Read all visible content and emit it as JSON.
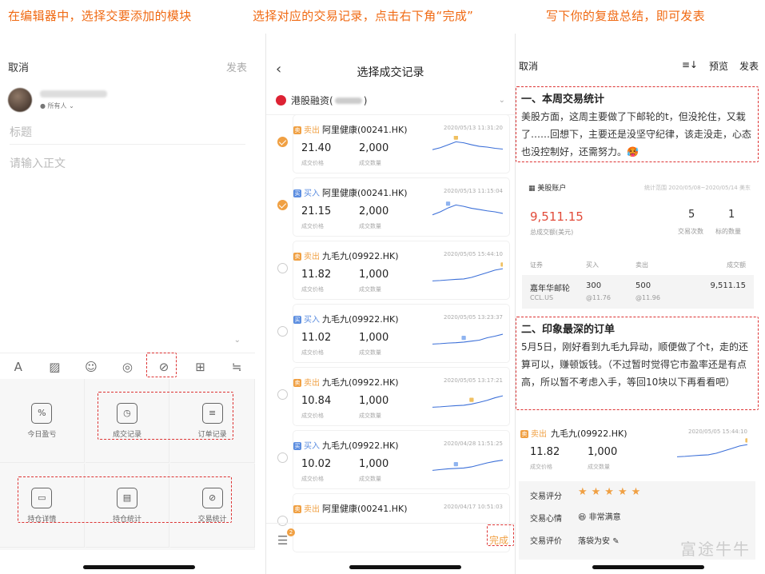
{
  "captions": [
    "在编辑器中，选择交要添加的模块",
    "选择对应的交易记录，点击右下角“完成”",
    "写下你的复盘总结，即可发表"
  ],
  "editor": {
    "cancel": "取消",
    "publish": "发表",
    "visibility": "所有人",
    "title_placeholder": "标题",
    "body_placeholder": "请输入正文",
    "toolbar_icons": [
      "font-icon",
      "image-icon",
      "emoji-icon",
      "stock-icon",
      "trade-chart-icon",
      "add-icon",
      "wrap-icon"
    ],
    "modules": [
      {
        "label": "今日盈亏",
        "icon": "%"
      },
      {
        "label": "成交记录",
        "icon": "◷"
      },
      {
        "label": "订单记录",
        "icon": "≡"
      },
      {
        "label": "持仓详情",
        "icon": "▭"
      },
      {
        "label": "持仓统计",
        "icon": "▤"
      },
      {
        "label": "交易统计",
        "icon": "⊘"
      }
    ]
  },
  "select": {
    "back": "‹",
    "title": "选择成交记录",
    "account": "港股融资(",
    "account_suffix": ")",
    "done": "完成",
    "badge": "2",
    "price_label": "成交价格",
    "qty_label": "成交数量",
    "records": [
      {
        "side": "卖出",
        "type": "sell",
        "name": "阿里健康(00241.HK)",
        "time": "2020/05/13 11:31:20",
        "price": "21.40",
        "qty": "2,000",
        "checked": true,
        "trend": [
          0.45,
          0.55,
          0.7,
          0.85,
          0.8,
          0.7,
          0.62,
          0.58,
          0.52,
          0.48
        ],
        "marker": 3
      },
      {
        "side": "买入",
        "type": "buy",
        "name": "阿里健康(00241.HK)",
        "time": "2020/05/13 11:15:04",
        "price": "21.15",
        "qty": "2,000",
        "checked": true,
        "trend": [
          0.35,
          0.5,
          0.7,
          0.85,
          0.78,
          0.68,
          0.62,
          0.55,
          0.5,
          0.42
        ],
        "marker": 2
      },
      {
        "side": "卖出",
        "type": "sell",
        "name": "九毛九(09922.HK)",
        "time": "2020/05/05 15:44:10",
        "price": "11.82",
        "qty": "1,000",
        "checked": false,
        "trend": [
          0.2,
          0.22,
          0.25,
          0.28,
          0.3,
          0.38,
          0.5,
          0.62,
          0.75,
          0.82
        ],
        "marker": 9
      },
      {
        "side": "买入",
        "type": "buy",
        "name": "九毛九(09922.HK)",
        "time": "2020/05/05 13:23:37",
        "price": "11.02",
        "qty": "1,000",
        "checked": false,
        "trend": [
          0.2,
          0.22,
          0.25,
          0.27,
          0.3,
          0.35,
          0.4,
          0.52,
          0.6,
          0.7
        ],
        "marker": 4
      },
      {
        "side": "卖出",
        "type": "sell",
        "name": "九毛九(09922.HK)",
        "time": "2020/05/05 13:17:21",
        "price": "10.84",
        "qty": "1,000",
        "checked": false,
        "trend": [
          0.2,
          0.22,
          0.25,
          0.28,
          0.3,
          0.36,
          0.45,
          0.55,
          0.68,
          0.78
        ],
        "marker": 5
      },
      {
        "side": "买入",
        "type": "buy",
        "name": "九毛九(09922.HK)",
        "time": "2020/04/28 11:51:25",
        "price": "10.02",
        "qty": "1,000",
        "checked": false,
        "trend": [
          0.2,
          0.24,
          0.28,
          0.3,
          0.32,
          0.38,
          0.48,
          0.58,
          0.66,
          0.72
        ],
        "marker": 3
      },
      {
        "side": "卖出",
        "type": "sell",
        "name": "阿里健康(00241.HK)",
        "time": "2020/04/17 10:51:03",
        "price": "",
        "qty": "",
        "checked": false,
        "trend": [],
        "marker": 0
      }
    ]
  },
  "review": {
    "cancel": "取消",
    "sort_icon": "≡↓",
    "preview": "预览",
    "publish": "发表",
    "sec1_title": "一、本周交易统计",
    "sec1_text": "美股方面，这周主要做了下邮轮的t，但没抡住，又栽了……回想下，主要还是没坚守纪律，该走没走，心态也没控制好，还需努力。",
    "sec1_emoji": "🥵",
    "stat": {
      "account": "美股账户",
      "range": "统计范围 2020/05/08~2020/05/14 美东",
      "total": "9,511.15",
      "total_label": "总成交额(美元)",
      "count": "5",
      "count_label": "交易次数",
      "targets": "1",
      "targets_label": "标的数量",
      "headers": [
        "证券",
        "买入",
        "卖出",
        "成交额"
      ],
      "row": {
        "name": "嘉年华邮轮",
        "code": "CCL.US",
        "buy": "300",
        "buy_price": "@11.76",
        "sell": "500",
        "sell_price": "@11.96",
        "amount": "9,511.15"
      }
    },
    "sec2_title": "二、印象最深的订单",
    "sec2_text": "5月5日，刚好看到九毛九异动，顺便做了个t，走的还算可以，赚顿饭钱。（不过暂时觉得它市盈率还是有点高，所以暂不考虑入手，等回10块以下再看看吧）",
    "trade": {
      "side": "卖出",
      "name": "九毛九(09922.HK)",
      "time": "2020/05/05 15:44:10",
      "price": "11.82",
      "price_label": "成交价格",
      "qty": "1,000",
      "qty_label": "成交数量",
      "rating_label": "交易评分",
      "stars": "★★★★★",
      "mood_label": "交易心情",
      "mood": "非常满意",
      "mood_emoji": "😆",
      "eval_label": "交易评价",
      "eval": "落袋为安"
    },
    "watermark": "富途牛牛"
  }
}
